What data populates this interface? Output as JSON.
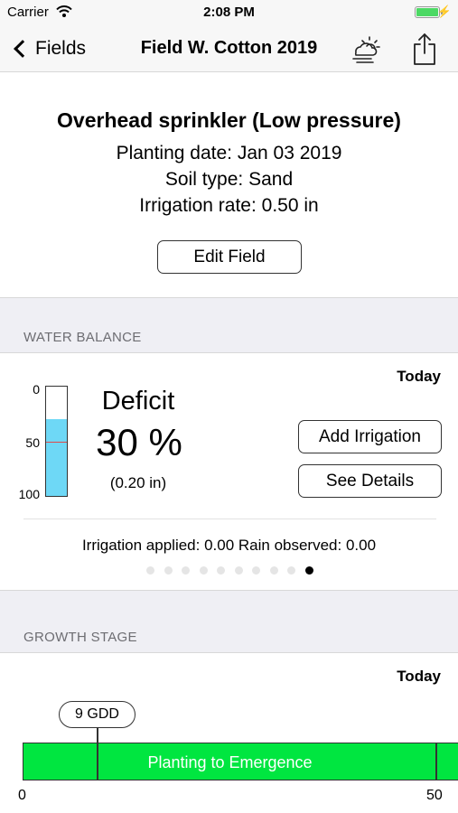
{
  "status_bar": {
    "carrier": "Carrier",
    "time": "2:08 PM",
    "wifi_icon": "wifi-icon",
    "battery_icon": "battery-icon",
    "battery_level": 1.0,
    "charging_icon": "lightning-icon"
  },
  "nav": {
    "back_label": "Fields",
    "back_icon": "chevron-left-icon",
    "title": "Field W. Cotton 2019",
    "weather_icon": "weather-icon",
    "share_icon": "share-icon"
  },
  "field": {
    "method": "Overhead sprinkler (Low pressure)",
    "planting_date": "Planting date: Jan 03 2019",
    "soil_type": "Soil type: Sand",
    "irrigation_rate": "Irrigation rate: 0.50 in",
    "edit_label": "Edit Field"
  },
  "water_balance": {
    "section_title": "WATER BALANCE",
    "today_label": "Today",
    "gauge_ticks": [
      "0",
      "50",
      "100"
    ],
    "gauge_fill_percent": 70,
    "gauge_fill_color": "#6ed8f6",
    "deficit_label": "Deficit",
    "deficit_value": "30 %",
    "deficit_inches": "(0.20 in)",
    "add_irrigation_label": "Add Irrigation",
    "see_details_label": "See Details",
    "observations": "Irrigation applied: 0.00  Rain observed: 0.00",
    "page_count": 10,
    "active_page": 10
  },
  "growth_stage": {
    "section_title": "GROWTH STAGE",
    "today_label": "Today",
    "gdd_callout": "9 GDD",
    "stage_name": "Planting to Emergence",
    "stage_color": "#00e640",
    "axis_start": "0",
    "axis_end": "50"
  }
}
